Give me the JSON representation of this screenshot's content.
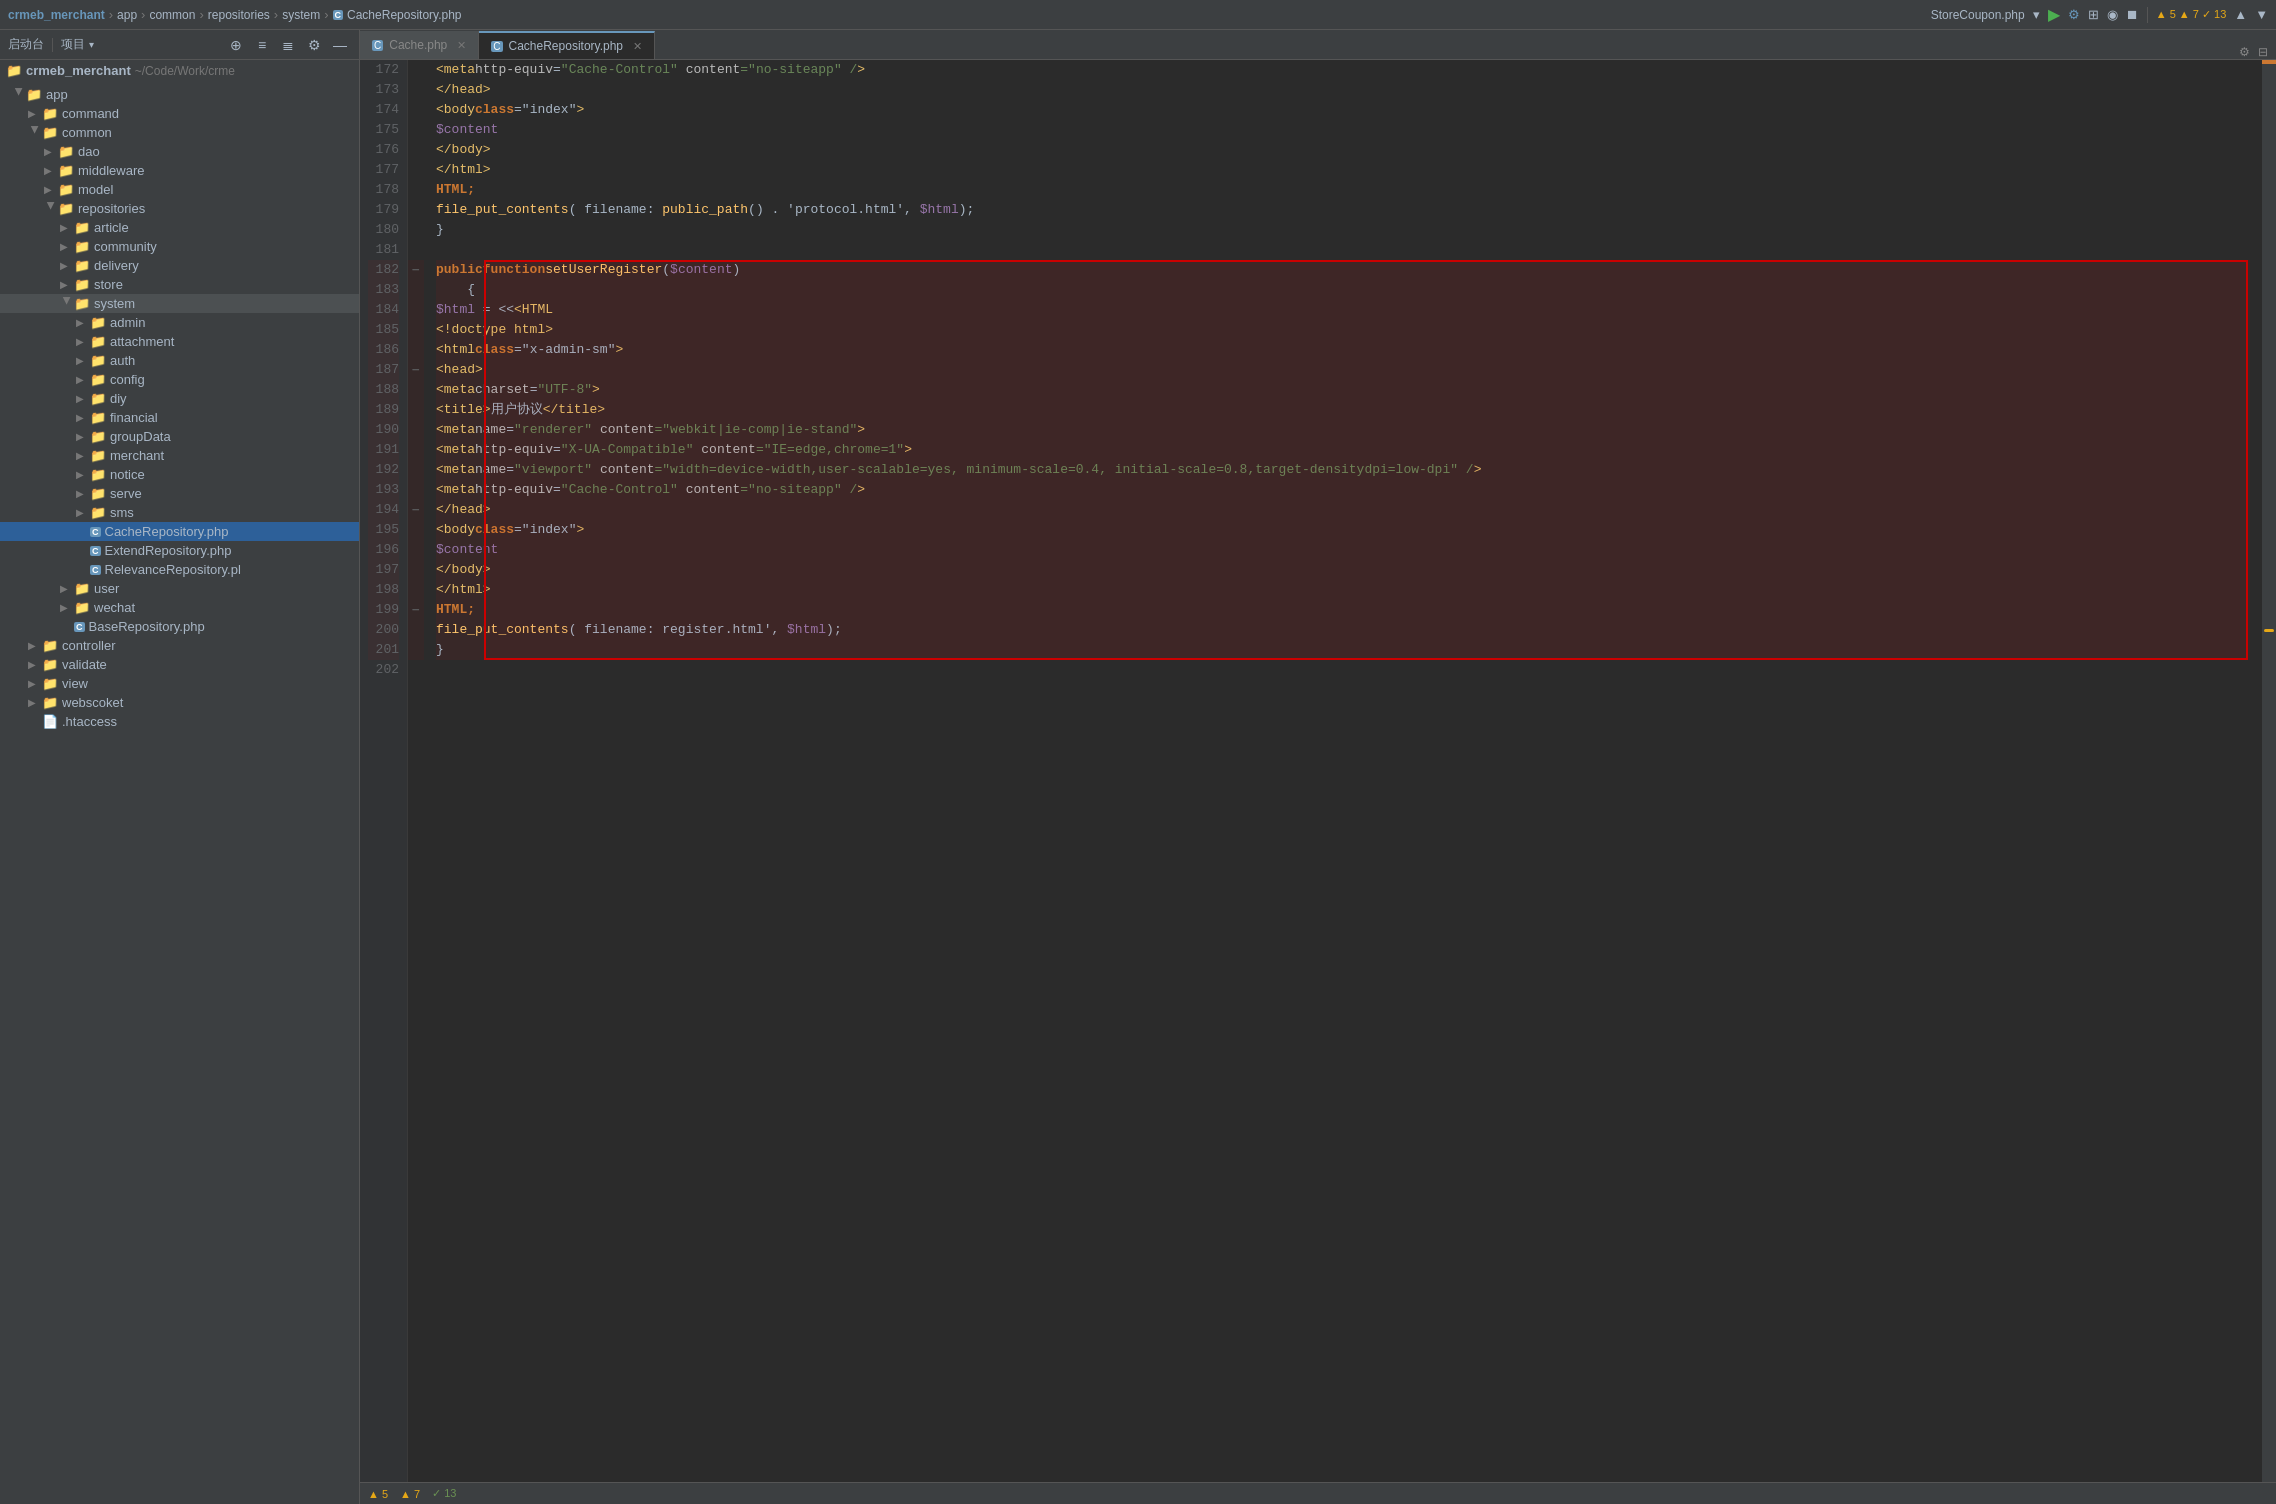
{
  "topbar": {
    "project": "crmeb_merchant",
    "path1": "app",
    "path2": "common",
    "path3": "repositories",
    "path4": "system",
    "file": "CacheRepository.php",
    "runFile": "StoreCoupon.php",
    "warnings": "▲ 5  ▲ 7  ✓ 13"
  },
  "sidebar": {
    "rootLabel": "crmeb_merchant",
    "rootPath": "~/Code/Work/crme",
    "toolbar": {
      "projectLabel": "项目",
      "icons": [
        "⊕",
        "≡",
        "≣",
        "⚙",
        "—"
      ]
    },
    "bottomLabel": "启动台",
    "tree": [
      {
        "id": "app",
        "label": "app",
        "type": "dir",
        "level": 1,
        "open": true
      },
      {
        "id": "command",
        "label": "command",
        "type": "dir",
        "level": 2
      },
      {
        "id": "common",
        "label": "common",
        "type": "dir",
        "level": 2,
        "open": true
      },
      {
        "id": "dao",
        "label": "dao",
        "type": "dir",
        "level": 3
      },
      {
        "id": "middleware",
        "label": "middleware",
        "type": "dir",
        "level": 3
      },
      {
        "id": "model",
        "label": "model",
        "type": "dir",
        "level": 3
      },
      {
        "id": "repositories",
        "label": "repositories",
        "type": "dir",
        "level": 3,
        "open": true
      },
      {
        "id": "article",
        "label": "article",
        "type": "dir",
        "level": 4
      },
      {
        "id": "community",
        "label": "community",
        "type": "dir",
        "level": 4
      },
      {
        "id": "delivery",
        "label": "delivery",
        "type": "dir",
        "level": 4
      },
      {
        "id": "store",
        "label": "store",
        "type": "dir",
        "level": 4
      },
      {
        "id": "system",
        "label": "system",
        "type": "dir",
        "level": 4,
        "open": true,
        "selected": true
      },
      {
        "id": "admin",
        "label": "admin",
        "type": "dir",
        "level": 5
      },
      {
        "id": "attachment",
        "label": "attachment",
        "type": "dir",
        "level": 5
      },
      {
        "id": "auth",
        "label": "auth",
        "type": "dir",
        "level": 5
      },
      {
        "id": "config",
        "label": "config",
        "type": "dir",
        "level": 5
      },
      {
        "id": "diy",
        "label": "diy",
        "type": "dir",
        "level": 5
      },
      {
        "id": "financial",
        "label": "financial",
        "type": "dir",
        "level": 5
      },
      {
        "id": "groupData",
        "label": "groupData",
        "type": "dir",
        "level": 5
      },
      {
        "id": "merchant",
        "label": "merchant",
        "type": "dir",
        "level": 5
      },
      {
        "id": "notice",
        "label": "notice",
        "type": "dir",
        "level": 5
      },
      {
        "id": "serve",
        "label": "serve",
        "type": "dir",
        "level": 5
      },
      {
        "id": "sms",
        "label": "sms",
        "type": "dir",
        "level": 5
      },
      {
        "id": "CacheRepository",
        "label": "CacheRepository.php",
        "type": "file",
        "level": 5,
        "selected": true
      },
      {
        "id": "ExtendRepository",
        "label": "ExtendRepository.php",
        "type": "file",
        "level": 5
      },
      {
        "id": "RelevanceRepository",
        "label": "RelevanceRepository.pl",
        "type": "file",
        "level": 5
      },
      {
        "id": "user",
        "label": "user",
        "type": "dir",
        "level": 4
      },
      {
        "id": "wechat",
        "label": "wechat",
        "type": "dir",
        "level": 4
      },
      {
        "id": "BaseRepository",
        "label": "BaseRepository.php",
        "type": "file",
        "level": 4
      },
      {
        "id": "controller",
        "label": "controller",
        "type": "dir",
        "level": 2
      },
      {
        "id": "validate",
        "label": "validate",
        "type": "dir",
        "level": 2
      },
      {
        "id": "view",
        "label": "view",
        "type": "dir",
        "level": 2
      },
      {
        "id": "webscoket",
        "label": "webscoket",
        "type": "dir",
        "level": 2
      },
      {
        "id": "htaccess",
        "label": ".htaccess",
        "type": "file",
        "level": 2
      }
    ]
  },
  "editor": {
    "tabs": [
      {
        "label": "Cache.php",
        "active": false,
        "icon": "C"
      },
      {
        "label": "CacheRepository.php",
        "active": true,
        "icon": "C"
      }
    ],
    "lines": [
      {
        "num": 172,
        "content": "    <meta http-equiv=\"Cache-Control\" content=\"no-siteapp\" />",
        "highlighted": false
      },
      {
        "num": 173,
        "content": "</head>",
        "highlighted": false
      },
      {
        "num": 174,
        "content": "<body class=\"index\">",
        "highlighted": false
      },
      {
        "num": 175,
        "content": "    $content",
        "highlighted": false
      },
      {
        "num": 176,
        "content": "</body>",
        "highlighted": false
      },
      {
        "num": 177,
        "content": "</html>",
        "highlighted": false
      },
      {
        "num": 178,
        "content": "HTML;",
        "highlighted": false
      },
      {
        "num": 179,
        "content": "        file_put_contents( filename: public_path() . 'protocol.html', $html);",
        "highlighted": false
      },
      {
        "num": 180,
        "content": "}",
        "highlighted": false
      },
      {
        "num": 181,
        "content": "",
        "highlighted": false
      },
      {
        "num": 182,
        "content": "    public function setUserRegister($content)",
        "highlighted": true
      },
      {
        "num": 183,
        "content": "    {",
        "highlighted": true
      },
      {
        "num": 184,
        "content": "        $html = <<<HTML",
        "highlighted": true
      },
      {
        "num": 185,
        "content": "<!doctype html>",
        "highlighted": true
      },
      {
        "num": 186,
        "content": "<html class=\"x-admin-sm\">",
        "highlighted": true
      },
      {
        "num": 187,
        "content": "    <head>",
        "highlighted": true
      },
      {
        "num": 188,
        "content": "        <meta charset=\"UTF-8\">",
        "highlighted": true
      },
      {
        "num": 189,
        "content": "        <title>用户协议</title>",
        "highlighted": true
      },
      {
        "num": 190,
        "content": "        <meta name=\"renderer\" content=\"webkit|ie-comp|ie-stand\">",
        "highlighted": true
      },
      {
        "num": 191,
        "content": "        <meta http-equiv=\"X-UA-Compatible\" content=\"IE=edge,chrome=1\">",
        "highlighted": true
      },
      {
        "num": 192,
        "content": "        <meta name=\"viewport\" content=\"width=device-width,user-scalable=yes, minimum-scale=0.4, initial-scale=0.8,target-densitydpi=low-dpi\" />",
        "highlighted": true
      },
      {
        "num": 193,
        "content": "        <meta http-equiv=\"Cache-Control\" content=\"no-siteapp\" />",
        "highlighted": true
      },
      {
        "num": 194,
        "content": "    </head>",
        "highlighted": true
      },
      {
        "num": 195,
        "content": "    <body class=\"index\">",
        "highlighted": true
      },
      {
        "num": 196,
        "content": "    $content",
        "highlighted": true
      },
      {
        "num": 197,
        "content": "    </body>",
        "highlighted": true
      },
      {
        "num": 198,
        "content": "</html>",
        "highlighted": true
      },
      {
        "num": 199,
        "content": "HTML;",
        "highlighted": true
      },
      {
        "num": 200,
        "content": "        file_put_contents( filename: register.html', $html);",
        "highlighted": true
      },
      {
        "num": 201,
        "content": "}",
        "highlighted": true
      },
      {
        "num": 202,
        "content": "",
        "highlighted": false
      }
    ]
  }
}
